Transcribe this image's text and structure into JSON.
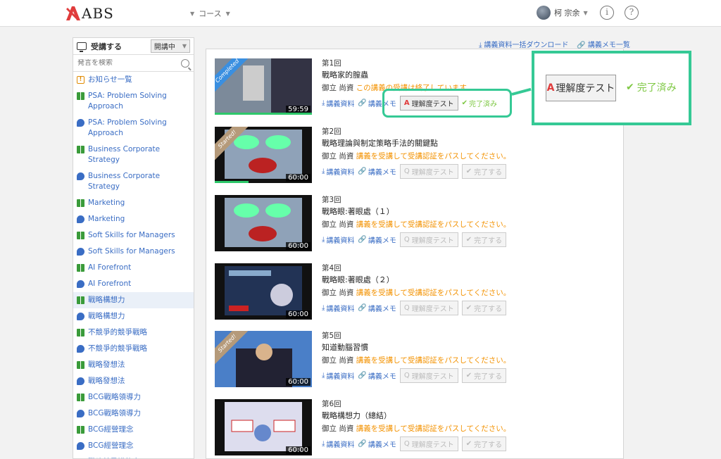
{
  "header": {
    "logo_text": "ABS",
    "nav_course": "コース",
    "user_name": "柯 宗余",
    "info_icon": "i",
    "help_icon": "?"
  },
  "sidebar": {
    "title": "受講する",
    "status_select": "開講中",
    "search_placeholder": "発言を検索",
    "items": [
      {
        "label": "お知らせ一覧",
        "icon": "info-icon"
      },
      {
        "label": "PSA: Problem Solving Approach",
        "icon": "book-icon"
      },
      {
        "label": "PSA: Problem Solving Approach",
        "icon": "chat-icon"
      },
      {
        "label": "Business Corporate Strategy",
        "icon": "book-icon"
      },
      {
        "label": "Business Corporate Strategy",
        "icon": "chat-icon"
      },
      {
        "label": "Marketing",
        "icon": "book-icon"
      },
      {
        "label": "Marketing",
        "icon": "chat-icon"
      },
      {
        "label": "Soft Skills for Managers",
        "icon": "book-icon"
      },
      {
        "label": "Soft Skills for Managers",
        "icon": "chat-icon"
      },
      {
        "label": "AI Forefront",
        "icon": "book-icon"
      },
      {
        "label": "AI Forefront",
        "icon": "chat-icon"
      },
      {
        "label": "戰略構想力",
        "icon": "book-icon"
      },
      {
        "label": "戰略構想力",
        "icon": "chat-icon"
      },
      {
        "label": "不競爭的競爭戰略",
        "icon": "book-icon"
      },
      {
        "label": "不競爭的競爭戰略",
        "icon": "chat-icon"
      },
      {
        "label": "戰略發想法",
        "icon": "book-icon"
      },
      {
        "label": "戰略發想法",
        "icon": "chat-icon"
      },
      {
        "label": "BCG戰略領導力",
        "icon": "book-icon"
      },
      {
        "label": "BCG戰略領導力",
        "icon": "chat-icon"
      },
      {
        "label": "BCG經營理念",
        "icon": "book-icon"
      },
      {
        "label": "BCG經營理念",
        "icon": "chat-icon"
      },
      {
        "label": "戰略就是講故事",
        "icon": "book-icon"
      }
    ]
  },
  "toplinks": {
    "download_all": "講義資料一括ダウンロード",
    "memo_list": "講義メモ一覧"
  },
  "lessons": [
    {
      "num": "第1回",
      "title": "戰略家的膣蟲",
      "author": "御立 尚資",
      "status_msg": "この講義の受講は終了しています。",
      "duration": "59:59",
      "ribbon": "Completed",
      "progress": 1.0,
      "done_label": "完了済み",
      "test_label": "理解度テスト"
    },
    {
      "num": "第2回",
      "title": "戰略理論與制定策略手法的關鍵點",
      "author": "御立 尚資",
      "status_msg": "講義を受講して受講認証をパスしてください。",
      "duration": "60:00",
      "ribbon": "Started!",
      "progress": 0.35,
      "done_label": "完了する",
      "test_label": "理解度テスト"
    },
    {
      "num": "第3回",
      "title": "戰略眼:著眼處（１）",
      "author": "御立 尚資",
      "status_msg": "講義を受講して受講認証をパスしてください。",
      "duration": "60:00",
      "ribbon": "",
      "progress": 0,
      "done_label": "完了する",
      "test_label": "理解度テスト"
    },
    {
      "num": "第4回",
      "title": "戰略眼:著眼處（２）",
      "author": "御立 尚資",
      "status_msg": "講義を受講して受講認証をパスしてください。",
      "duration": "60:00",
      "ribbon": "",
      "progress": 0,
      "done_label": "完了する",
      "test_label": "理解度テスト"
    },
    {
      "num": "第5回",
      "title": "知道動腦習慣",
      "author": "御立 尚資",
      "status_msg": "講義を受講して受講認証をパスしてください。",
      "duration": "60:00",
      "ribbon": "Started!",
      "progress": 0,
      "done_label": "完了する",
      "test_label": "理解度テスト"
    },
    {
      "num": "第6回",
      "title": "戰略構想力（總結）",
      "author": "御立 尚資",
      "status_msg": "講義を受講して受講認証をパスしてください。",
      "duration": "60:00",
      "ribbon": "",
      "progress": 0,
      "done_label": "完了する",
      "test_label": "理解度テスト"
    }
  ],
  "action_labels": {
    "materials": "講義資料",
    "memo": "講義メモ"
  },
  "callout": {
    "test_label": "理解度テスト",
    "done_label": "完了済み"
  },
  "colors": {
    "accent_green": "#35c995",
    "done_green": "#7ec843",
    "orange_msg": "#f39200",
    "link_blue": "#3a6dc4",
    "brand_red": "#e03c3c"
  }
}
